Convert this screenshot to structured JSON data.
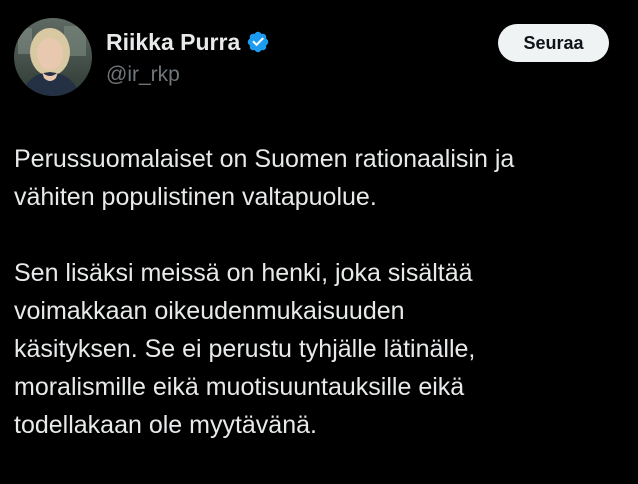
{
  "author": {
    "display_name": "Riikka Purra",
    "handle": "@ir_rkp",
    "verified": true,
    "verified_icon": "verified-badge-icon",
    "verified_color": "#1d9bf0"
  },
  "actions": {
    "follow_label": "Seuraa"
  },
  "tweet": {
    "paragraphs": [
      {
        "lines": [
          "Perussuomalaiset on Suomen rationaalisin ja",
          "vähiten populistinen valtapuolue."
        ]
      },
      {
        "lines": [
          "Sen lisäksi meissä on henki, joka sisältää",
          "voimakkaan oikeudenmukaisuuden",
          "käsityksen. Se ei perustu tyhjälle lätinälle,",
          "moralismille eikä muotisuuntauksille eikä",
          "todellakaan ole myytävänä."
        ]
      }
    ]
  },
  "colors": {
    "background": "#000000",
    "text": "#e7e9ea",
    "secondary_text": "#71767b",
    "button_bg": "#eff3f4",
    "button_text": "#0f1419"
  }
}
